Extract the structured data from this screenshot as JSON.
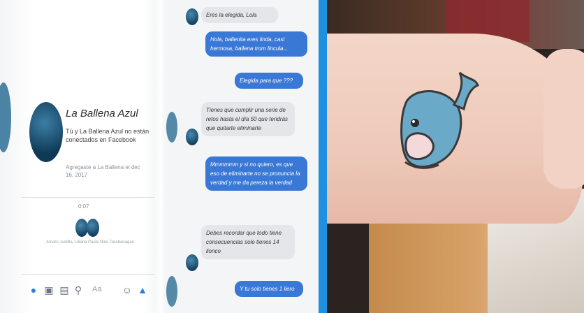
{
  "profile": {
    "name": "La Ballena Azul",
    "description": "Tú y La Ballena Azul no están conectados en Facebook",
    "added": "Agregaste a La Ballena el dec 16, 2017",
    "mutual_count": "0:07",
    "mutual_text": "Amaru Justilla, Liliana Paula Nino Tarabanagan"
  },
  "chat": {
    "messages": [
      {
        "from": "them",
        "text": "Eres la elegida, Lola"
      },
      {
        "from": "me",
        "text": "Hola, ballenita eres linda, casi hermosa, ballena trom lincula..."
      },
      {
        "from": "me",
        "text": "Elegida para que ???"
      },
      {
        "from": "them",
        "text": "Tienes que cumplir una serie de retos hasta el día 50 que tendrás que quitarte eliminarte"
      },
      {
        "from": "me",
        "text": "Mmmmmm y si no quiero, es que eso de eliminarte no se pronuncia la verdad y me da pereza la verdad"
      },
      {
        "from": "them",
        "text": "Debes recordar que todo tiene consecuencias solo tienes 14 lionco"
      },
      {
        "from": "me",
        "text": "Y tu solo tienes 1 liero"
      }
    ]
  },
  "toolbar": {
    "text_placeholder": "Aa"
  },
  "colors": {
    "accent": "#3a78d6",
    "divider": "#1f8fe0",
    "tattoo": "#6aa9c7"
  },
  "icons": [
    "camera-icon",
    "gallery-icon",
    "sticker-icon",
    "mic-icon",
    "emoji-icon",
    "like-icon"
  ]
}
